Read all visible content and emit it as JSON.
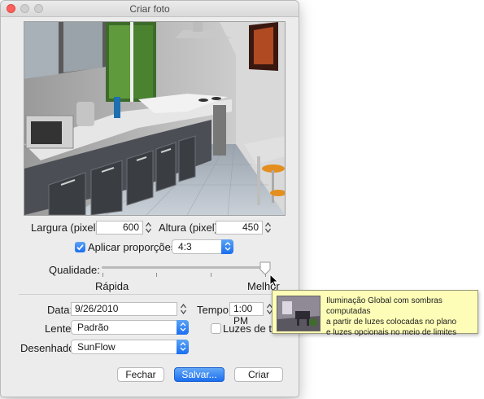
{
  "window": {
    "title": "Criar foto",
    "buttons": {
      "close": "close",
      "minimize": "minimize",
      "zoom": "zoom"
    }
  },
  "size": {
    "width_label": "Largura (pixel):",
    "width_value": "600",
    "height_label": "Altura (pixel):",
    "height_value": "450"
  },
  "proportions": {
    "checkbox_label": "Aplicar proporções:",
    "checked": true,
    "ratio": "4:3"
  },
  "quality": {
    "label": "Qualidade:",
    "min_label": "Rápida",
    "max_label": "Melhor",
    "level": 1.0,
    "ticks": 4
  },
  "date": {
    "label": "Data:",
    "value": "9/26/2010"
  },
  "time": {
    "label": "Tempo:",
    "value": "1:00 PM"
  },
  "lens": {
    "label": "Lente:",
    "value": "Padrão"
  },
  "ceiling_lights": {
    "label": "Luzes de teto",
    "checked": false
  },
  "renderer": {
    "label": "Desenhador:",
    "value": "SunFlow"
  },
  "actions": {
    "close": "Fechar",
    "save": "Salvar...",
    "create": "Criar"
  },
  "tooltip": {
    "line1": "Iluminação Global com sombras computadas",
    "line2": "a partir de luzes colocadas no plano",
    "line3": "e luzes opcionais no meio de limites"
  },
  "colors": {
    "accent": "#1a6df0",
    "close_light": "#fc605c",
    "tooltip_bg": "#fdfdb7"
  }
}
